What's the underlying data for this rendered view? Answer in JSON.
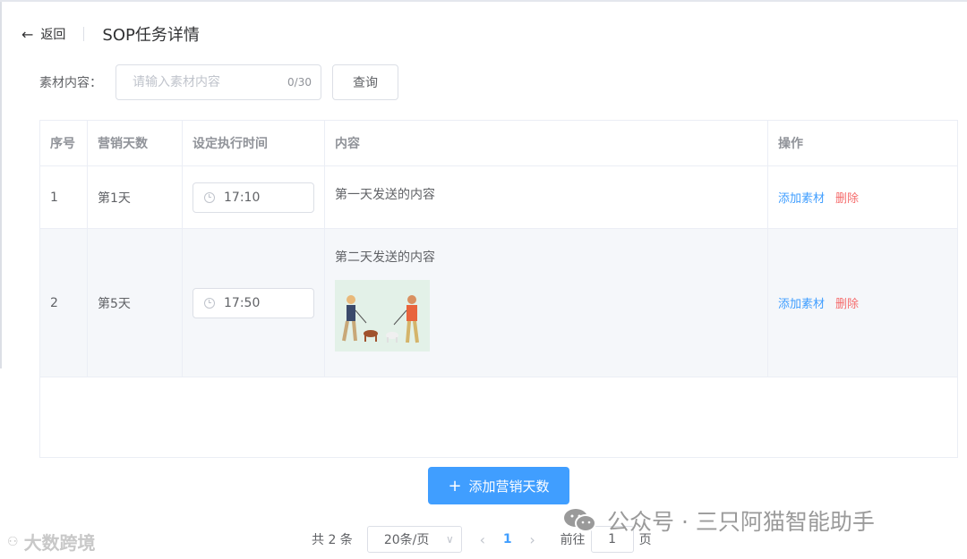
{
  "header": {
    "back_label": "返回",
    "title": "SOP任务详情"
  },
  "search": {
    "label": "素材内容：",
    "placeholder": "请输入素材内容",
    "count": "0/30",
    "query_label": "查询"
  },
  "table": {
    "columns": [
      "序号",
      "营销天数",
      "设定执行时间",
      "内容",
      "操作"
    ],
    "rows": [
      {
        "index": "1",
        "day": "第1天",
        "time": "17:10",
        "content": "第一天发送的内容"
      },
      {
        "index": "2",
        "day": "第5天",
        "time": "17:50",
        "content": "第二天发送的内容"
      }
    ],
    "actions": {
      "add": "添加素材",
      "delete": "删除"
    }
  },
  "add_button": {
    "plus": "+",
    "label": "添加营销天数"
  },
  "pager": {
    "total": "共 2 条",
    "size": "20条/页",
    "current": "1",
    "goto": "前往",
    "goto_value": "1",
    "page_suffix": "页"
  },
  "watermarks": {
    "left": "大数跨境",
    "right": "公众号 · 三只阿猫智能助手"
  },
  "colors": {
    "primary": "#409eff",
    "danger": "#f56c6c",
    "border": "#ebeef5"
  }
}
